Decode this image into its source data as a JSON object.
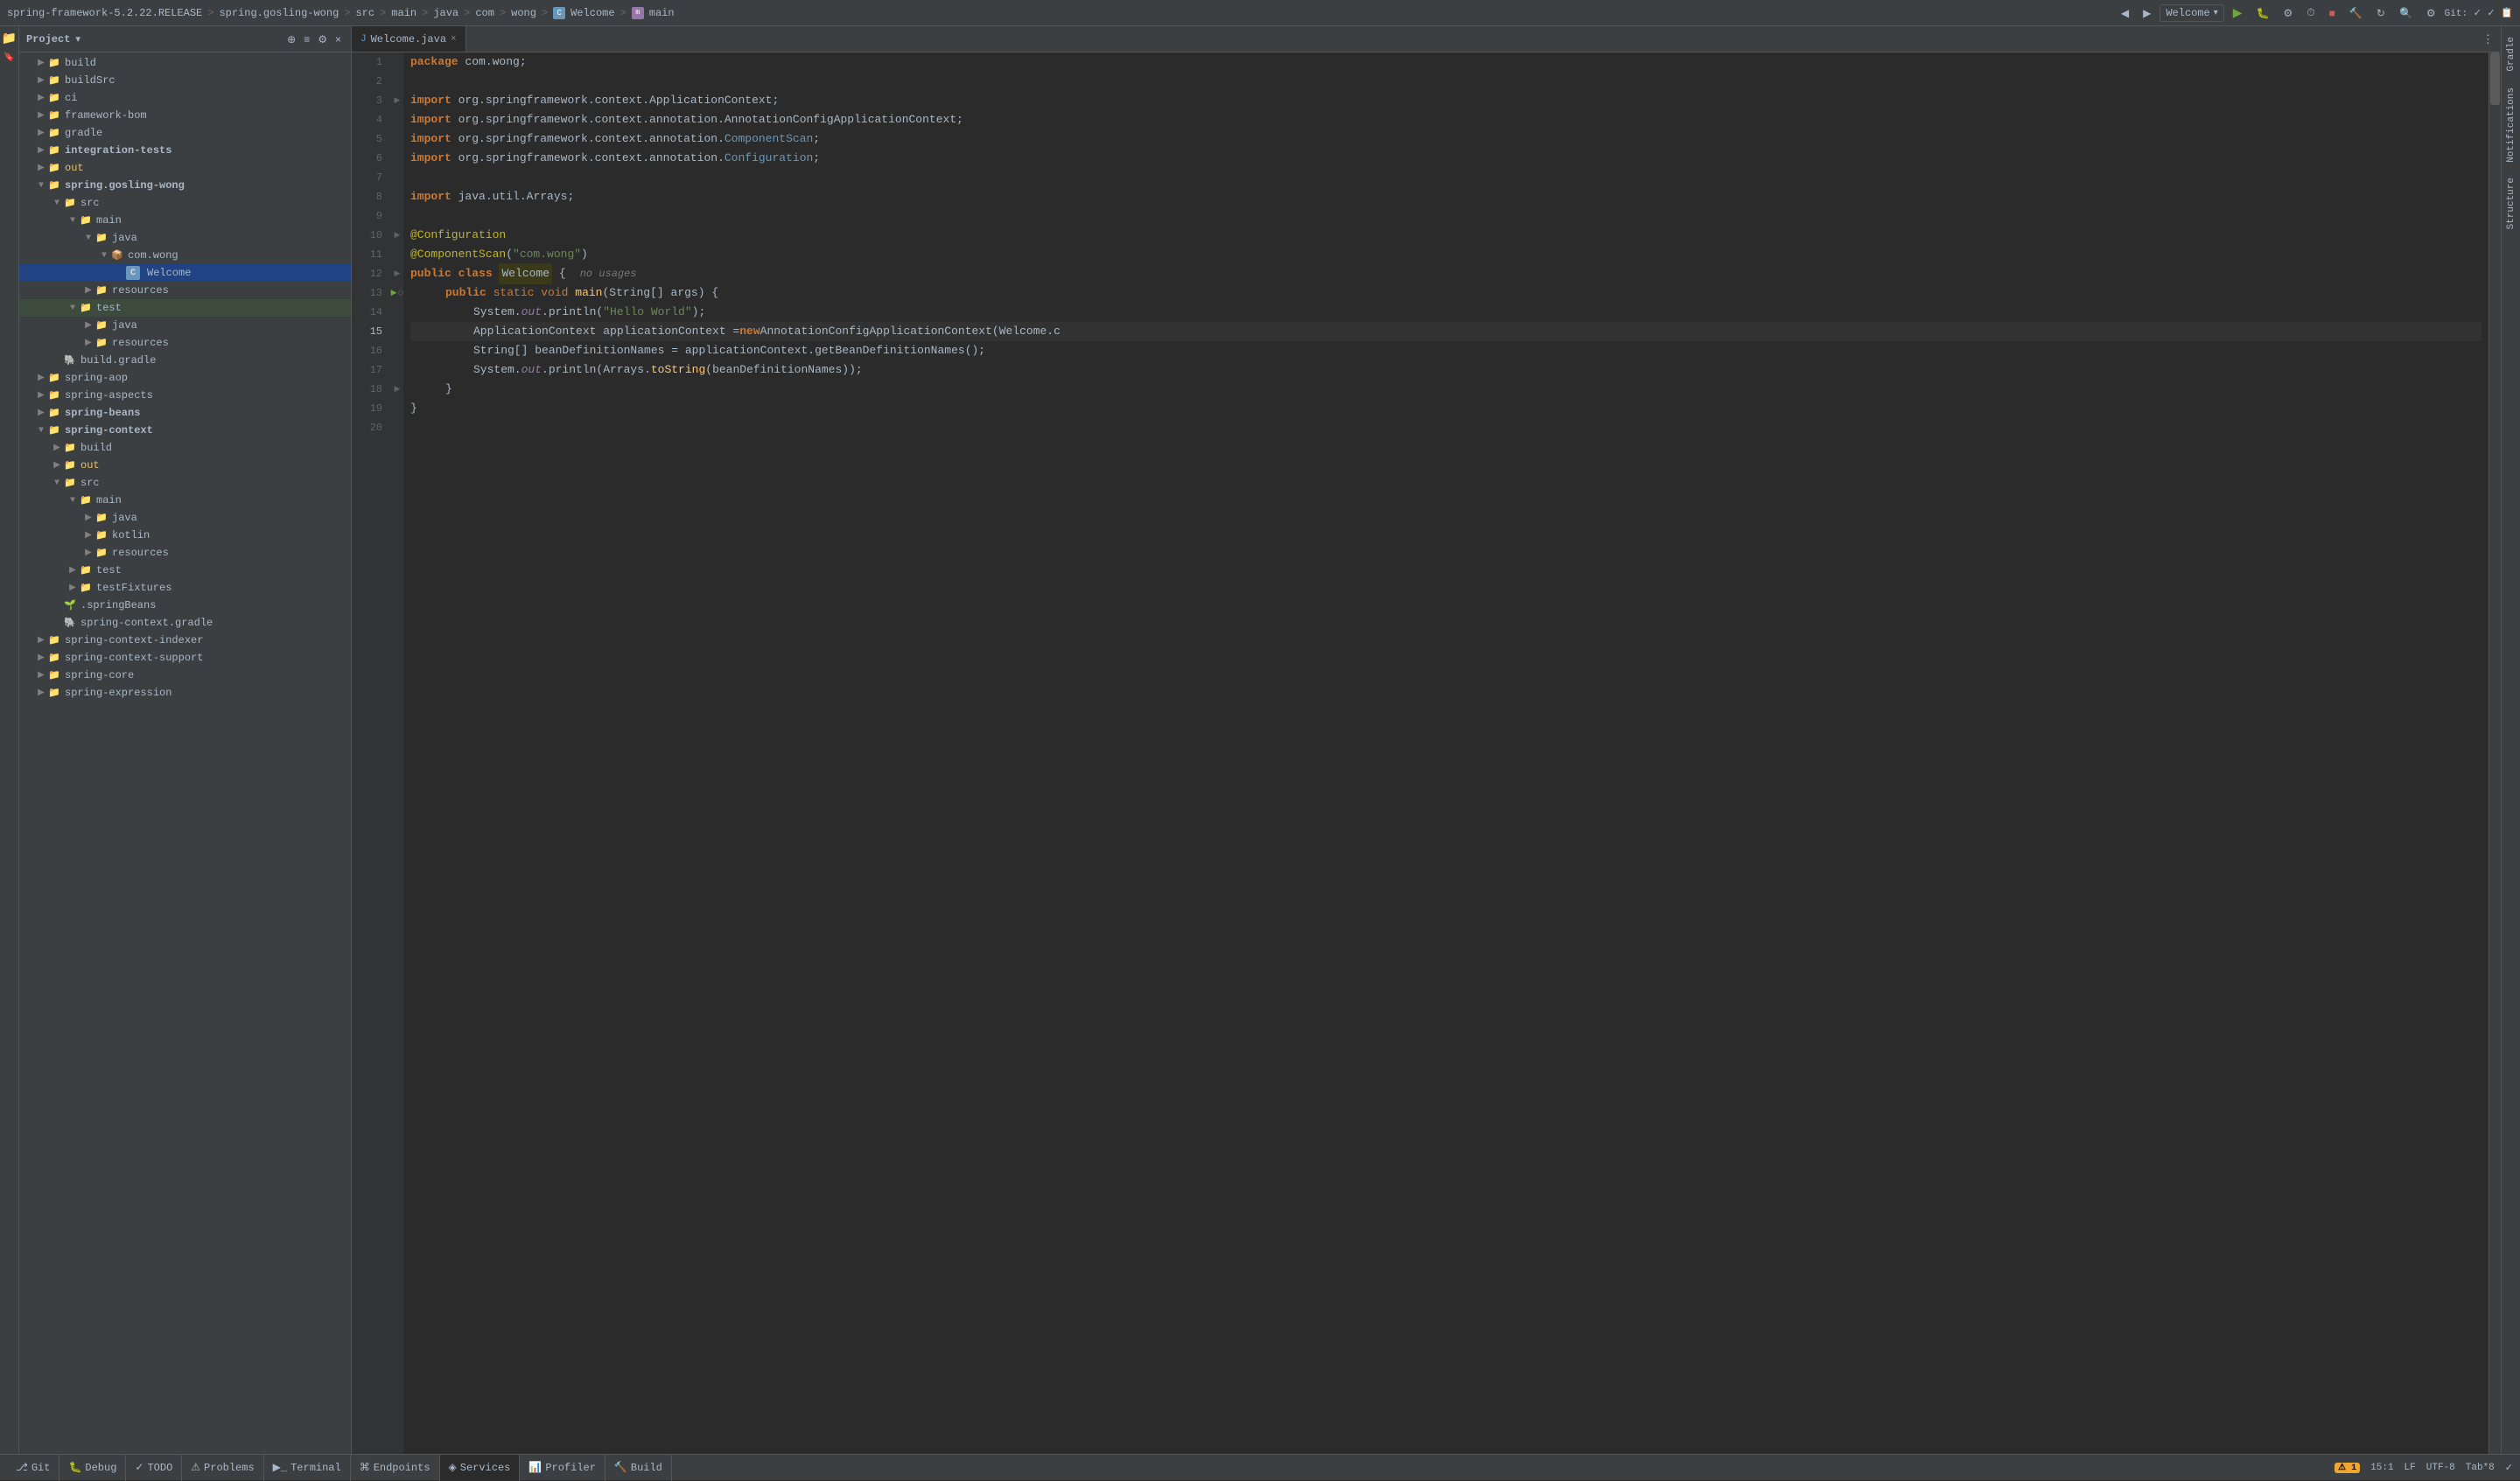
{
  "topbar": {
    "project": "spring-framework-5.2.22.RELEASE",
    "sep1": ">",
    "module": "spring.gosling-wong",
    "sep2": ">",
    "src": "src",
    "sep3": ">",
    "main": "main",
    "sep4": ">",
    "java": "java",
    "sep5": ">",
    "com": "com",
    "sep6": ">",
    "wong": "wong",
    "sep7": ">",
    "class_icon": "C",
    "class_name": "Welcome",
    "sep8": ">",
    "method_icon": "m",
    "method_name": "main",
    "run_config": "Welcome"
  },
  "panel": {
    "title": "Project",
    "dropdown_icon": "▾"
  },
  "tree": [
    {
      "indent": 1,
      "type": "folder",
      "arrow": "▶",
      "label": "build",
      "color": "normal"
    },
    {
      "indent": 1,
      "type": "folder",
      "arrow": "▶",
      "label": "buildSrc",
      "color": "normal"
    },
    {
      "indent": 1,
      "type": "folder",
      "arrow": "▶",
      "label": "ci",
      "color": "normal"
    },
    {
      "indent": 1,
      "type": "folder",
      "arrow": "▶",
      "label": "framework-bom",
      "color": "normal"
    },
    {
      "indent": 1,
      "type": "folder",
      "arrow": "▶",
      "label": "gradle",
      "color": "normal"
    },
    {
      "indent": 1,
      "type": "folder",
      "arrow": "▶",
      "label": "integration-tests",
      "color": "normal"
    },
    {
      "indent": 1,
      "type": "folder",
      "arrow": "▶",
      "label": "out",
      "color": "yellow"
    },
    {
      "indent": 1,
      "type": "folder-open",
      "arrow": "▼",
      "label": "spring.gosling-wong",
      "color": "normal"
    },
    {
      "indent": 2,
      "type": "folder-open",
      "arrow": "▼",
      "label": "src",
      "color": "blue-src"
    },
    {
      "indent": 3,
      "type": "folder-open",
      "arrow": "▼",
      "label": "main",
      "color": "blue-src"
    },
    {
      "indent": 4,
      "type": "folder-open",
      "arrow": "▼",
      "label": "java",
      "color": "blue-src"
    },
    {
      "indent": 5,
      "type": "folder-open",
      "arrow": "▼",
      "label": "com.wong",
      "color": "normal"
    },
    {
      "indent": 6,
      "type": "java-class",
      "arrow": "",
      "label": "Welcome",
      "color": "normal",
      "selected": true
    },
    {
      "indent": 4,
      "type": "folder",
      "arrow": "▶",
      "label": "resources",
      "color": "normal"
    },
    {
      "indent": 3,
      "type": "folder-open",
      "arrow": "▼",
      "label": "test",
      "color": "normal",
      "highlighted": true
    },
    {
      "indent": 4,
      "type": "folder",
      "arrow": "▶",
      "label": "java",
      "color": "blue-src"
    },
    {
      "indent": 4,
      "type": "folder",
      "arrow": "▶",
      "label": "resources",
      "color": "normal"
    },
    {
      "indent": 2,
      "type": "gradle",
      "arrow": "",
      "label": "build.gradle",
      "color": "normal"
    },
    {
      "indent": 1,
      "type": "folder",
      "arrow": "▶",
      "label": "spring-aop",
      "color": "normal"
    },
    {
      "indent": 1,
      "type": "folder",
      "arrow": "▶",
      "label": "spring-aspects",
      "color": "normal"
    },
    {
      "indent": 1,
      "type": "folder",
      "arrow": "▶",
      "label": "spring-beans",
      "color": "normal"
    },
    {
      "indent": 1,
      "type": "folder-open",
      "arrow": "▼",
      "label": "spring-context",
      "color": "normal"
    },
    {
      "indent": 2,
      "type": "folder",
      "arrow": "▶",
      "label": "build",
      "color": "normal"
    },
    {
      "indent": 2,
      "type": "folder",
      "arrow": "▶",
      "label": "out",
      "color": "yellow"
    },
    {
      "indent": 2,
      "type": "folder-open",
      "arrow": "▼",
      "label": "src",
      "color": "blue-src"
    },
    {
      "indent": 3,
      "type": "folder-open",
      "arrow": "▼",
      "label": "main",
      "color": "blue-src"
    },
    {
      "indent": 4,
      "type": "folder",
      "arrow": "▶",
      "label": "java",
      "color": "blue-src"
    },
    {
      "indent": 4,
      "type": "folder",
      "arrow": "▶",
      "label": "kotlin",
      "color": "normal"
    },
    {
      "indent": 4,
      "type": "folder",
      "arrow": "▶",
      "label": "resources",
      "color": "normal"
    },
    {
      "indent": 3,
      "type": "folder",
      "arrow": "▶",
      "label": "test",
      "color": "normal"
    },
    {
      "indent": 3,
      "type": "folder",
      "arrow": "▶",
      "label": "testFixtures",
      "color": "normal"
    },
    {
      "indent": 2,
      "type": "springbeans",
      "arrow": "",
      "label": ".springBeans",
      "color": "normal"
    },
    {
      "indent": 2,
      "type": "gradle",
      "arrow": "",
      "label": "spring-context.gradle",
      "color": "normal"
    },
    {
      "indent": 1,
      "type": "folder",
      "arrow": "▶",
      "label": "spring-context-indexer",
      "color": "normal"
    },
    {
      "indent": 1,
      "type": "folder",
      "arrow": "▶",
      "label": "spring-context-support",
      "color": "normal"
    },
    {
      "indent": 1,
      "type": "folder",
      "arrow": "▶",
      "label": "spring-core",
      "color": "normal"
    },
    {
      "indent": 1,
      "type": "folder",
      "arrow": "▶",
      "label": "spring-expression",
      "color": "normal"
    }
  ],
  "editor": {
    "tab_label": "Welcome.java",
    "tab_modified": false
  },
  "code_lines": [
    {
      "num": 1,
      "content": "package",
      "type": "package",
      "warning": true
    },
    {
      "num": 2,
      "content": "",
      "type": "empty"
    },
    {
      "num": 3,
      "content": "import_line",
      "type": "import",
      "fold": true
    },
    {
      "num": 4,
      "content": "import_line2",
      "type": "import"
    },
    {
      "num": 5,
      "content": "import_line3",
      "type": "import"
    },
    {
      "num": 6,
      "content": "import_line4",
      "type": "import"
    },
    {
      "num": 7,
      "content": "",
      "type": "empty"
    },
    {
      "num": 8,
      "content": "import_util",
      "type": "import"
    },
    {
      "num": 9,
      "content": "",
      "type": "empty"
    },
    {
      "num": 10,
      "content": "@Configuration",
      "type": "annotation",
      "fold": true
    },
    {
      "num": 11,
      "content": "@ComponentScan",
      "type": "annotation"
    },
    {
      "num": 12,
      "content": "class_decl",
      "type": "class",
      "run": true
    },
    {
      "num": 13,
      "content": "main_method",
      "type": "method",
      "run": true,
      "fold": true
    },
    {
      "num": 14,
      "content": "sysout1",
      "type": "code"
    },
    {
      "num": 15,
      "content": "appctx",
      "type": "code",
      "current": true
    },
    {
      "num": 16,
      "content": "beannames",
      "type": "code"
    },
    {
      "num": 17,
      "content": "sysout2",
      "type": "code"
    },
    {
      "num": 18,
      "content": "close_brace",
      "type": "code",
      "fold": true
    },
    {
      "num": 19,
      "content": "outer_close",
      "type": "code"
    },
    {
      "num": 20,
      "content": "",
      "type": "empty"
    }
  ],
  "bottom_tabs": [
    {
      "id": "git",
      "label": "Git",
      "icon": "git"
    },
    {
      "id": "debug",
      "label": "Debug",
      "icon": "bug"
    },
    {
      "id": "todo",
      "label": "TODO",
      "icon": "todo"
    },
    {
      "id": "problems",
      "label": "Problems",
      "icon": "problems"
    },
    {
      "id": "terminal",
      "label": "Terminal",
      "icon": "terminal"
    },
    {
      "id": "endpoints",
      "label": "Endpoints",
      "icon": "endpoints"
    },
    {
      "id": "services",
      "label": "Services",
      "icon": "services",
      "active": true
    },
    {
      "id": "profiler",
      "label": "Profiler",
      "icon": "profiler"
    },
    {
      "id": "build",
      "label": "Build",
      "icon": "build"
    }
  ],
  "status_bar": {
    "position": "15:1",
    "encoding": "LF",
    "charset": "UTF-8",
    "indent": "Tab*8",
    "warning_count": "1"
  },
  "right_panels": [
    {
      "id": "gradle",
      "label": "Gradle"
    },
    {
      "id": "notifications",
      "label": "Notifications"
    },
    {
      "id": "structure",
      "label": "Structure"
    }
  ]
}
